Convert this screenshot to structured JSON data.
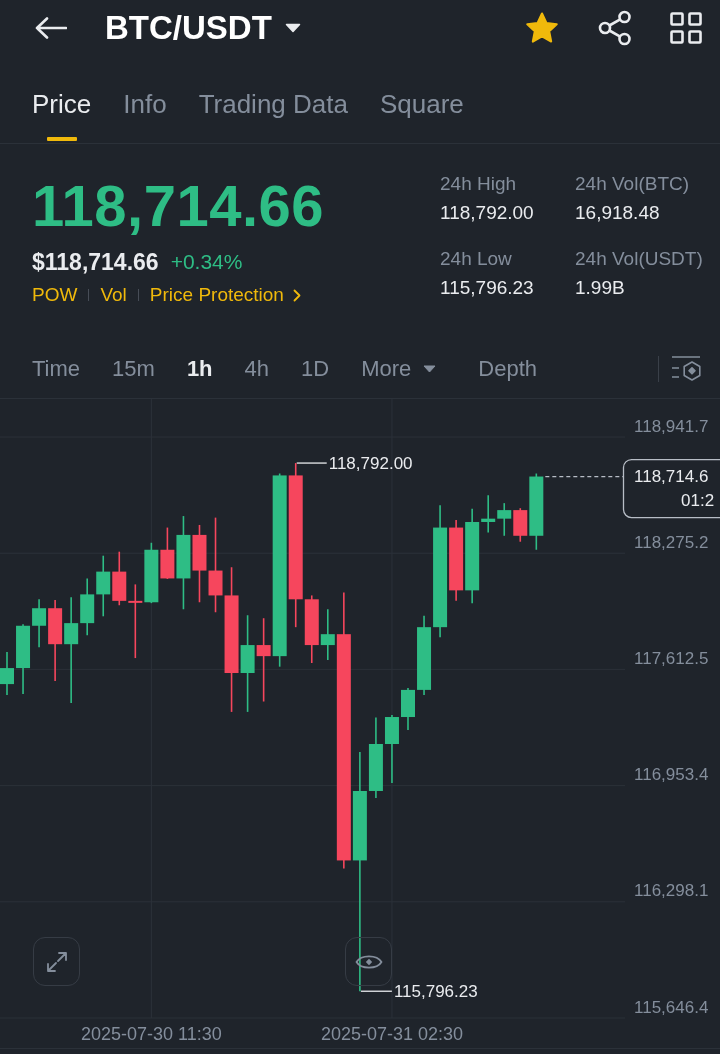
{
  "header": {
    "title": "BTC/USDT",
    "favorite": true
  },
  "tabs": [
    {
      "label": "Price",
      "selected": true
    },
    {
      "label": "Info",
      "selected": false
    },
    {
      "label": "Trading Data",
      "selected": false
    },
    {
      "label": "Square",
      "selected": false
    }
  ],
  "ticker": {
    "last_price": "118,714.66",
    "fiat_price": "$118,714.66",
    "change": "+0.34%",
    "tags": [
      {
        "label": "POW",
        "kind": "tag"
      },
      {
        "label": "Vol",
        "kind": "tag"
      },
      {
        "label": "Price Protection",
        "kind": "link"
      }
    ]
  },
  "stats": [
    {
      "label": "24h High",
      "value": "118,792.00"
    },
    {
      "label": "24h Vol(BTC)",
      "value": "16,918.48"
    },
    {
      "label": "24h Low",
      "value": "115,796.23"
    },
    {
      "label": "24h Vol(USDT)",
      "value": "1.99B"
    }
  ],
  "intervals": [
    {
      "label": "Time",
      "kind": "interval",
      "selected": false
    },
    {
      "label": "15m",
      "kind": "interval",
      "selected": false
    },
    {
      "label": "1h",
      "kind": "interval",
      "selected": true
    },
    {
      "label": "4h",
      "kind": "interval",
      "selected": false
    },
    {
      "label": "1D",
      "kind": "interval",
      "selected": false
    },
    {
      "label": "More",
      "kind": "dropdown",
      "selected": false
    },
    {
      "label": "Depth",
      "kind": "view",
      "selected": false
    }
  ],
  "chart": {
    "chart_data": {
      "type": "candlestick",
      "grid": true,
      "categories": [
        null,
        null,
        null,
        null,
        null,
        null,
        null,
        null,
        null,
        "2025-07-30 11:30",
        null,
        null,
        null,
        null,
        null,
        null,
        null,
        null,
        null,
        null,
        null,
        null,
        null,
        null,
        "2025-07-31 02:30",
        null,
        null,
        null,
        null,
        null,
        null,
        null,
        null,
        null
      ],
      "ohlc": [
        [
          117529,
          117711,
          117467,
          117620
        ],
        [
          117620,
          117870,
          117473,
          117861
        ],
        [
          117861,
          118012,
          117739,
          117961
        ],
        [
          117961,
          118008,
          117547,
          117756
        ],
        [
          117756,
          118023,
          117422,
          117876
        ],
        [
          117876,
          118131,
          117807,
          118040
        ],
        [
          118040,
          118261,
          117915,
          118170
        ],
        [
          118170,
          118284,
          117978,
          118003
        ],
        [
          118003,
          118097,
          117677,
          117995
        ],
        [
          117995,
          118335,
          117990,
          118295
        ],
        [
          118295,
          118422,
          118128,
          118131
        ],
        [
          118131,
          118488,
          117955,
          118380
        ],
        [
          118380,
          118437,
          117995,
          118176
        ],
        [
          118176,
          118479,
          117938,
          118034
        ],
        [
          118034,
          118195,
          117371,
          117592
        ],
        [
          117592,
          117921,
          117371,
          117751
        ],
        [
          117751,
          117904,
          117430,
          117688
        ],
        [
          117688,
          118732,
          117628,
          118721
        ],
        [
          118721,
          118792,
          117853,
          118012
        ],
        [
          118012,
          118034,
          117649,
          117751
        ],
        [
          117751,
          117955,
          117666,
          117813
        ],
        [
          117813,
          118051,
          116486,
          116531
        ],
        [
          116531,
          117144,
          115796.23,
          116923
        ],
        [
          116923,
          117339,
          116883,
          117189
        ],
        [
          117189,
          117354,
          116968,
          117342
        ],
        [
          117342,
          117507,
          117269,
          117496
        ],
        [
          117496,
          117918,
          117467,
          117853
        ],
        [
          117853,
          118550,
          117796,
          118422
        ],
        [
          118422,
          118465,
          118003,
          118063
        ],
        [
          118063,
          118530,
          117989,
          118454
        ],
        [
          118454,
          118607,
          118394,
          118473
        ],
        [
          118473,
          118562,
          118375,
          118522
        ],
        [
          118522,
          118533,
          118341,
          118375
        ],
        [
          118375,
          118732,
          118295,
          118714.66
        ]
      ],
      "ylim": [
        115646.4,
        119160.6
      ],
      "yticks": [
        {
          "value": 118941.7,
          "label": "118,941.7"
        },
        {
          "value": 118275.2,
          "label": "118,275.2"
        },
        {
          "value": 117612.5,
          "label": "117,612.5"
        },
        {
          "value": 116953.4,
          "label": "116,953.4"
        },
        {
          "value": 116298.1,
          "label": "116,298.1"
        },
        {
          "value": 115646.4,
          "label": "115,646.4"
        }
      ]
    },
    "high_marker": "118,792.00",
    "low_marker": "115,796.23",
    "last_price_tag": {
      "price": "118,714.6",
      "countdown": "01:2"
    }
  }
}
